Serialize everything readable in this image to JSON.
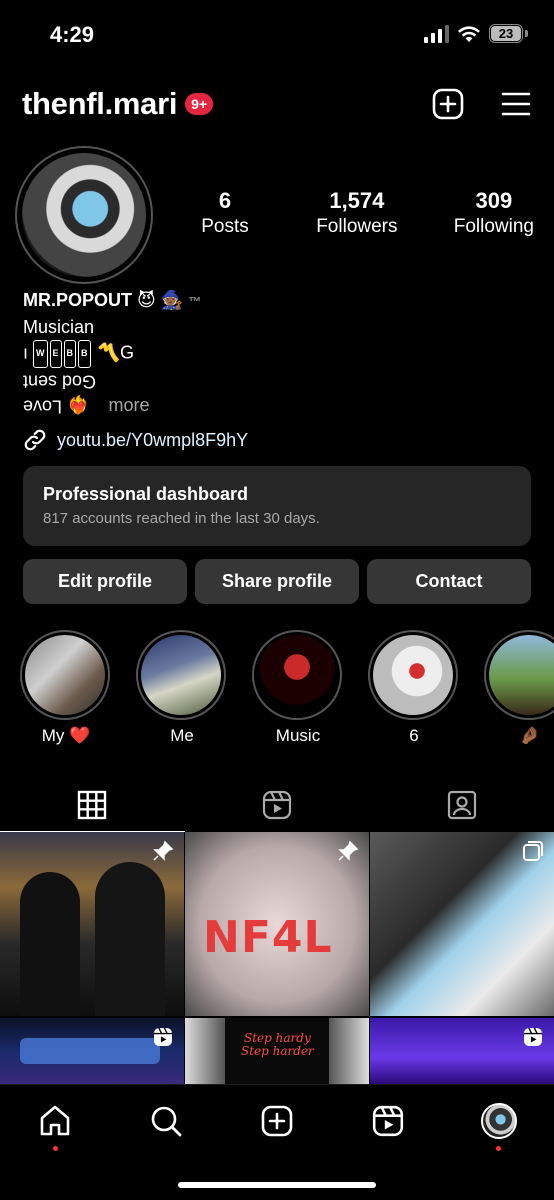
{
  "status_bar": {
    "time": "4:29",
    "battery": "23"
  },
  "header": {
    "username": "thenfl.mari",
    "notification_badge": "9+"
  },
  "stats": [
    {
      "value": "6",
      "label": "Posts"
    },
    {
      "value": "1,574",
      "label": "Followers"
    },
    {
      "value": "309",
      "label": "Following"
    }
  ],
  "bio": {
    "name": "MR.POPOUT",
    "name_emoji": "😈 🧙🏾",
    "trademark": "™",
    "category": "Musician",
    "line1_prefix": "ı",
    "line1_boxes": [
      "W",
      "E",
      "B",
      "B"
    ],
    "line1_suffix": "〽️G",
    "line2": "God sent",
    "line3": "Love",
    "line3_emoji": "❤️‍🔥",
    "more": "more"
  },
  "link": "youtu.be/Y0wmpl8F9hY",
  "dashboard": {
    "title": "Professional dashboard",
    "subtitle": "817 accounts reached in the last 30 days."
  },
  "buttons": {
    "edit": "Edit profile",
    "share": "Share profile",
    "contact": "Contact"
  },
  "highlights": [
    {
      "label": "My ❤️"
    },
    {
      "label": "Me"
    },
    {
      "label": "Music"
    },
    {
      "label": "6"
    },
    {
      "label": "🤌🏾"
    }
  ],
  "grid_text": {
    "nf4l": "NF4L",
    "stephardy": "Step hardy\nStep harder"
  },
  "colors": {
    "background": "#000000",
    "button": "#363636",
    "dashboard": "#262626",
    "badge": "#e8253f"
  }
}
